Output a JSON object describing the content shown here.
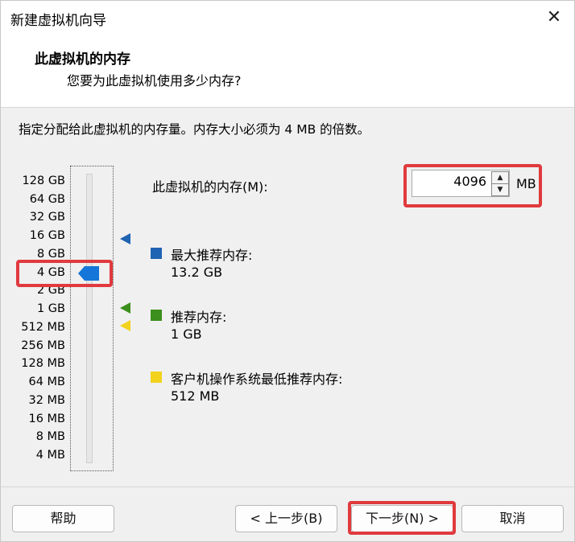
{
  "window": {
    "title": "新建虚拟机向导",
    "close_glyph": "✕"
  },
  "header": {
    "title": "此虚拟机的内存",
    "subtitle": "您要为此虚拟机使用多少内存?"
  },
  "instruction": "指定分配给此虚拟机的内存量。内存大小必须为 4 MB 的倍数。",
  "scale": {
    "labels": [
      "128 GB",
      "64 GB",
      "32 GB",
      "16 GB",
      "8 GB",
      "4 GB",
      "2 GB",
      "1 GB",
      "512 MB",
      "256 MB",
      "128 MB",
      "64 MB",
      "32 MB",
      "16 MB",
      "8 MB",
      "4 MB"
    ],
    "selected": "4 GB"
  },
  "memory": {
    "label": "此虚拟机的内存(M):",
    "value": "4096",
    "unit": "MB"
  },
  "legend": {
    "max": {
      "title": "最大推荐内存:",
      "value": "13.2 GB",
      "color": "#1f63b3"
    },
    "recommended": {
      "title": "推荐内存:",
      "value": "1 GB",
      "color": "#3c8f1c"
    },
    "min": {
      "title": "客户机操作系统最低推荐内存:",
      "value": "512 MB",
      "color": "#f2d21c"
    }
  },
  "buttons": {
    "help": "帮助",
    "back": "< 上一步(B)",
    "next": "下一步(N) >",
    "cancel": "取消"
  },
  "colors": {
    "highlight": "#e03a3e",
    "thumb": "#1476d8"
  }
}
